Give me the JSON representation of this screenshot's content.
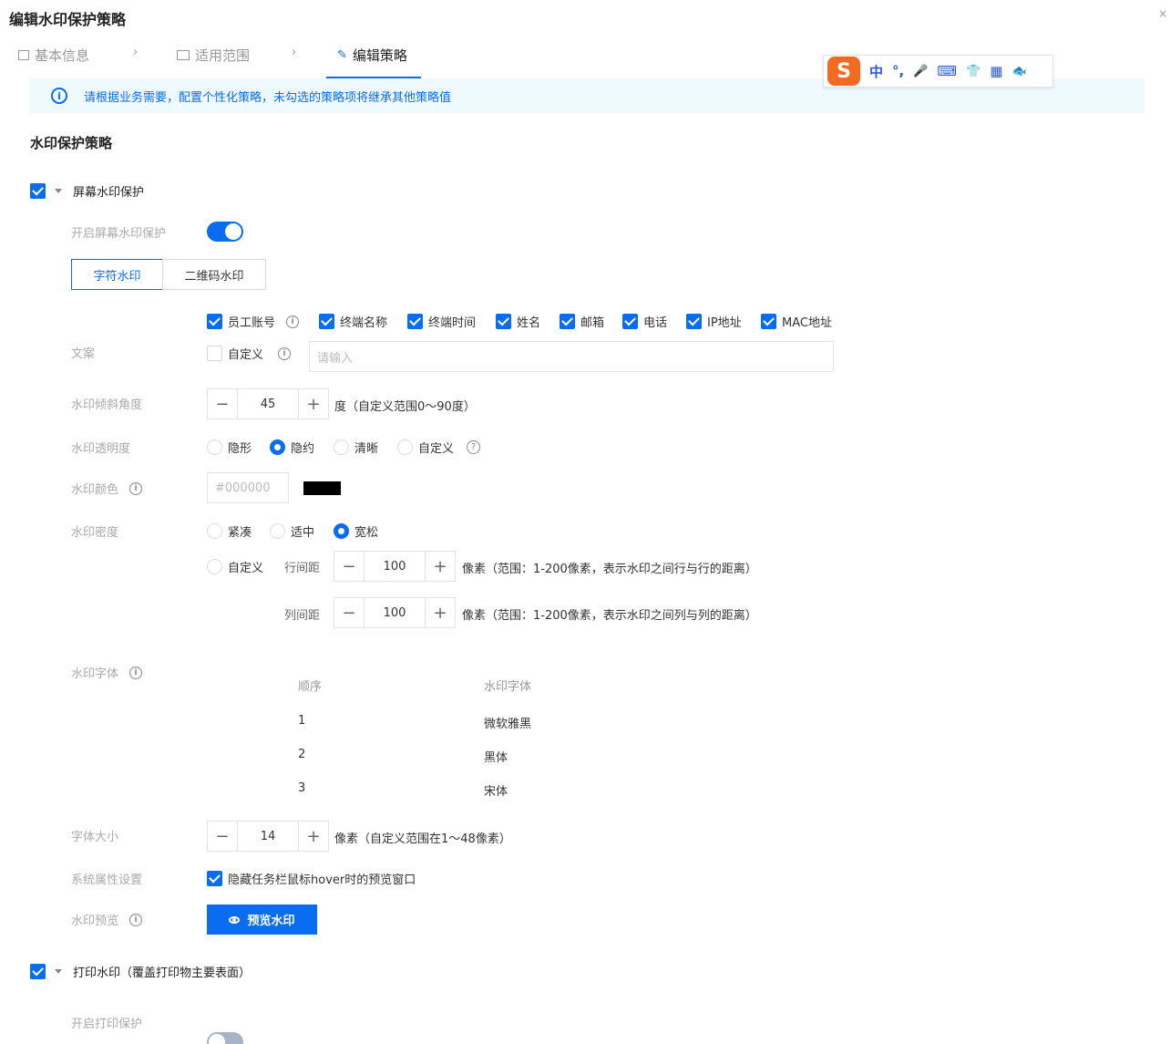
{
  "window": {
    "title": "编辑水印保护策略",
    "close": "×"
  },
  "steps": [
    {
      "label": "基本信息"
    },
    {
      "label": "适用范围"
    },
    {
      "label": "编辑策略"
    }
  ],
  "step_arrow": "›",
  "info": {
    "icon": "i",
    "text": "请根据业务需要，配置个性化策略，未勾选的策略项将继承其他策略值"
  },
  "ime": {
    "logo": "S",
    "items": [
      "中",
      "°,",
      "🎤",
      "⌨",
      "👕",
      "▦",
      "🐟"
    ]
  },
  "section_title": "水印保护策略",
  "screen_wm": {
    "title": "屏幕水印保护",
    "enable_label": "开启屏幕水印保护",
    "tabs": [
      "字符水印",
      "二维码水印"
    ],
    "content_label": "文案",
    "content_options": [
      "员工账号",
      "终端名称",
      "终端时间",
      "姓名",
      "邮箱",
      "电话",
      "IP地址",
      "MAC地址"
    ],
    "custom_label": "自定义",
    "custom_placeholder": "请输入",
    "angle_label": "水印倾斜角度",
    "angle_value": "45",
    "angle_unit": "度（自定义范围0～90度）",
    "opacity_label": "水印透明度",
    "opacity_options": [
      "隐形",
      "隐约",
      "清晰",
      "自定义"
    ],
    "color_label": "水印颜色",
    "color_placeholder": "#000000",
    "color_value": "#000000",
    "density_label": "水印密度",
    "density_options": [
      "紧凑",
      "适中",
      "宽松"
    ],
    "density_custom": "自定义",
    "row_gap_label": "行间距",
    "row_gap_value": "100",
    "row_gap_unit": "像素（范围：1-200像素，表示水印之间行与行的距离）",
    "col_gap_label": "列间距",
    "col_gap_value": "100",
    "col_gap_unit": "像素（范围：1-200像素，表示水印之间列与列的距离）",
    "font_label": "水印字体",
    "font_table": {
      "headers": [
        "顺序",
        "水印字体"
      ],
      "rows": [
        [
          "1",
          "微软雅黑"
        ],
        [
          "2",
          "黑体"
        ],
        [
          "3",
          "宋体"
        ]
      ]
    },
    "size_label": "字体大小",
    "size_value": "14",
    "size_unit": "像素（自定义范围在1～48像素）",
    "sys_label": "系统属性设置",
    "sys_option": "隐藏任务栏鼠标hover时的预览窗口",
    "preview_label": "水印预览",
    "preview_button": "预览水印"
  },
  "print_wm": {
    "title": "打印水印（覆盖打印物主要表面）",
    "enable_label": "开启打印保护"
  },
  "stepper": {
    "minus": "−",
    "plus": "+"
  },
  "i_glyph": "i",
  "q_glyph": "?"
}
